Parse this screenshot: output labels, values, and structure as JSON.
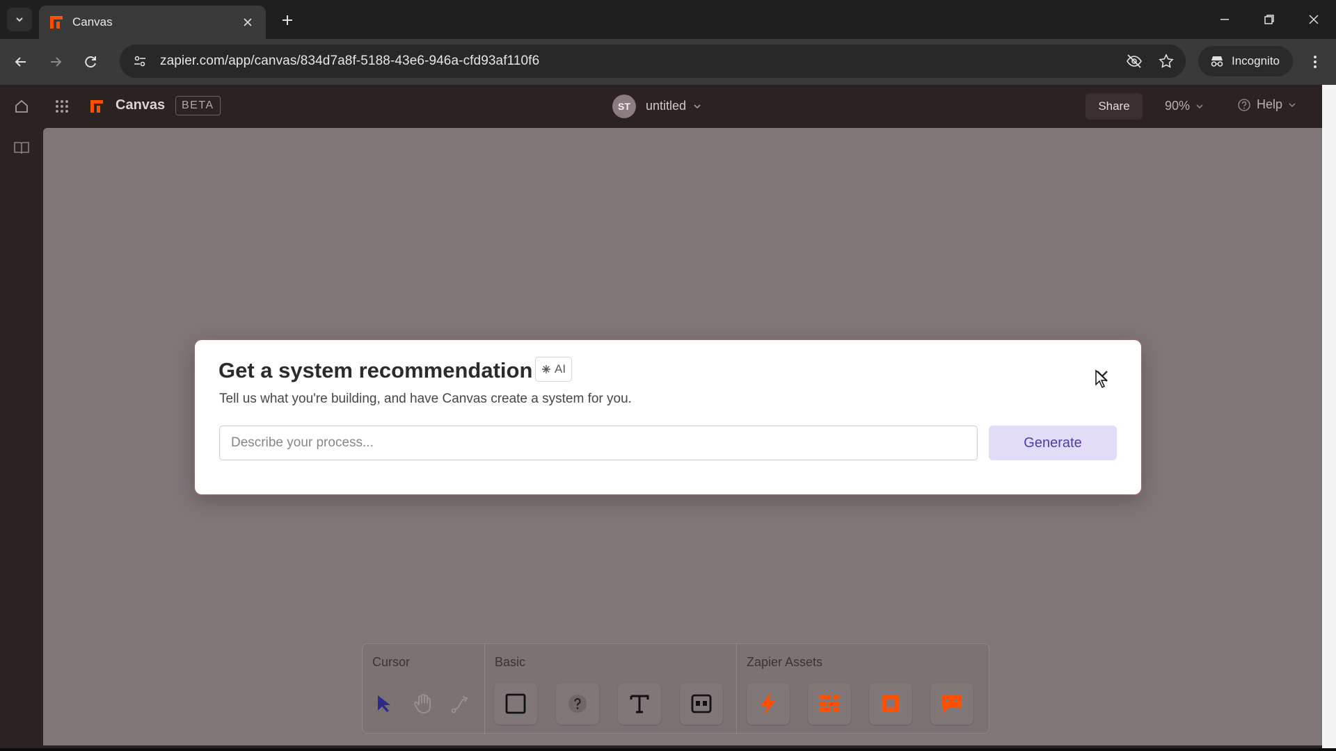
{
  "browser": {
    "tab_title": "Canvas",
    "url": "zapier.com/app/canvas/834d7a8f-5188-43e6-946a-cfd93af110f6",
    "incognito_label": "Incognito"
  },
  "header": {
    "app_name": "Canvas",
    "beta_label": "BETA",
    "avatar_initials": "ST",
    "doc_title": "untitled",
    "share_label": "Share",
    "zoom_label": "90%",
    "help_label": "Help"
  },
  "modal": {
    "title": "Get a system recommendation",
    "ai_badge": "AI",
    "subtitle": "Tell us what you're building, and have Canvas create a system for you.",
    "input_placeholder": "Describe your process...",
    "input_value": "",
    "generate_label": "Generate"
  },
  "toolbar": {
    "cursor_label": "Cursor",
    "basic_label": "Basic",
    "assets_label": "Zapier Assets",
    "cursor_tools": [
      "select-icon",
      "hand-icon",
      "connector-icon"
    ],
    "basic_tools": [
      "rectangle-icon",
      "question-icon",
      "text-icon",
      "card-icon"
    ],
    "asset_tools": [
      "zap-icon",
      "table-icon",
      "interface-icon",
      "chatbot-icon"
    ]
  },
  "colors": {
    "brand_orange": "#ff4f00",
    "canvas_bg": "#7e7677",
    "generate_bg": "#e2dcf7",
    "generate_text": "#4a3db0"
  }
}
